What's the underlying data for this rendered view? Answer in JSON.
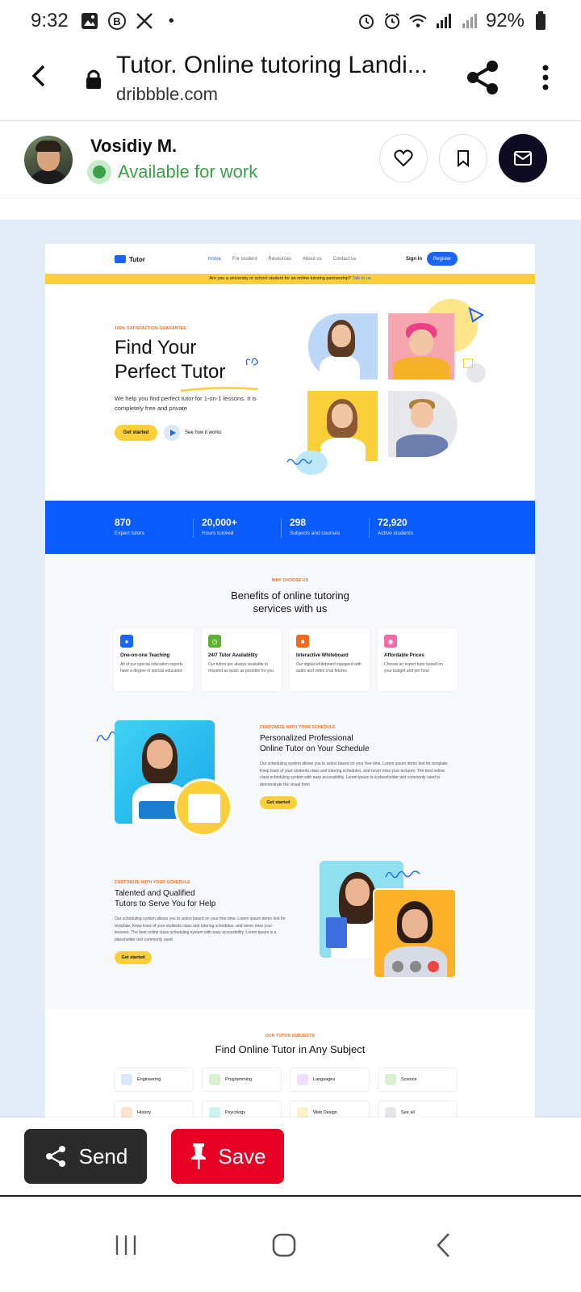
{
  "status": {
    "time": "9:32",
    "battery": "92%",
    "dot": "•"
  },
  "browser": {
    "title": "Tutor. Online tutoring Landi...",
    "domain": "dribbble.com"
  },
  "author": {
    "name": "Vosidiy M.",
    "availability": "Available for work"
  },
  "shot": {
    "logo": "Tutor",
    "nav": [
      "Home",
      "For student",
      "Resources",
      "About us",
      "Contact us"
    ],
    "sign_in": "Sign in",
    "register": "Register",
    "banner_text": "Are you a university or school student for an online tutoring partnership?",
    "banner_link": "Talk to us",
    "hero": {
      "kicker": "100% SATISFACTION GUARANTEE",
      "title_line1": "Find Your",
      "title_line2": "Perfect Tutor",
      "description": "We help you find perfect tutor for  1-on-1 lessons. It is completely free and private",
      "cta": "Get started",
      "secondary": "See how it works"
    },
    "stats": [
      {
        "value": "870",
        "label": "Expert tutors"
      },
      {
        "value": "20,000+",
        "label": "Hours tutored"
      },
      {
        "value": "298",
        "label": "Subjects and courses"
      },
      {
        "value": "72,920",
        "label": "Active students"
      }
    ],
    "benefits": {
      "kicker": "WHY CHOOSE US",
      "title_line1": "Benefits of online tutoring",
      "title_line2": "services with us",
      "cards": [
        {
          "title": "One-on-one Teaching",
          "desc": "All of our special education experts have a degree in special education",
          "color": "#1c64f2"
        },
        {
          "title": "24/7 Tutor Availability",
          "desc": "Our tutors are always available to respond as quick as possible for you",
          "color": "#5db32f"
        },
        {
          "title": "Interactive Whiteboard",
          "desc": "Our digital whiteboard equipped with audio and video chat fetures",
          "color": "#f26b1d"
        },
        {
          "title": "Affordable Prices",
          "desc": "Choose an expert tutor based on your budget and per hour",
          "color": "#f06aa8"
        }
      ]
    },
    "feature1": {
      "kicker": "CUSTOMIZE WITH YOUR SCHEDULE",
      "title_line1": "Personalized Professional",
      "title_line2": "Online Tutor on Your Schedule",
      "desc": "Our scheduling system allows you to select based on your free time. Lorem ipsum demo text for template. Keep track of your students class and tutoring schedules, and never miss your lectures. The best online class scheduling system with easy accessibility. Lorem ipsum is a placeholder text commonly used to demonstrate the visual form",
      "cta": "Get started"
    },
    "feature2": {
      "kicker": "CUSTOMIZE WITH YOUR SCHEDULE",
      "title_line1": "Talented and Qualified",
      "title_line2": "Tutors to Serve You for Help",
      "desc": "Our scheduling system allows you to select based on your free time. Lorem ipsum demo text for template. Keep track of your students class and tutoring schedules, and never miss your lectures. The best online class scheduling system with easy accessibility. Lorem ipsum is a placeholder text commonly used",
      "cta": "Get started"
    },
    "subjects": {
      "kicker": "OUR TUTOR SUBJECTS",
      "title": "Find Online Tutor in Any Subject",
      "items": [
        {
          "label": "Engineering",
          "color": "#1c64f2"
        },
        {
          "label": "Programming",
          "color": "#5db32f"
        },
        {
          "label": "Languages",
          "color": "#9b5de5"
        },
        {
          "label": "Science",
          "color": "#5db32f"
        },
        {
          "label": "History",
          "color": "#f26b1d"
        },
        {
          "label": "Psycology",
          "color": "#14b8a6"
        },
        {
          "label": "Web Design",
          "color": "#fbcf3a"
        },
        {
          "label": "See all",
          "color": "#888888"
        }
      ]
    }
  },
  "actions": {
    "send": "Send",
    "save": "Save"
  },
  "colors": {
    "brand_blue": "#0b5cff",
    "accent_yellow": "#fbcf3a",
    "save_red": "#e60023",
    "available_green": "#3aa14a"
  },
  "icons": [
    "image-icon",
    "b-icon",
    "x-icon",
    "alarm-icon",
    "wifi-icon",
    "signal-icon",
    "battery-icon",
    "back-icon",
    "lock-icon",
    "share-icon",
    "more-icon",
    "heart-icon",
    "bookmark-icon",
    "mail-icon",
    "pin-icon",
    "recents-icon",
    "home-icon",
    "nav-back-icon"
  ]
}
